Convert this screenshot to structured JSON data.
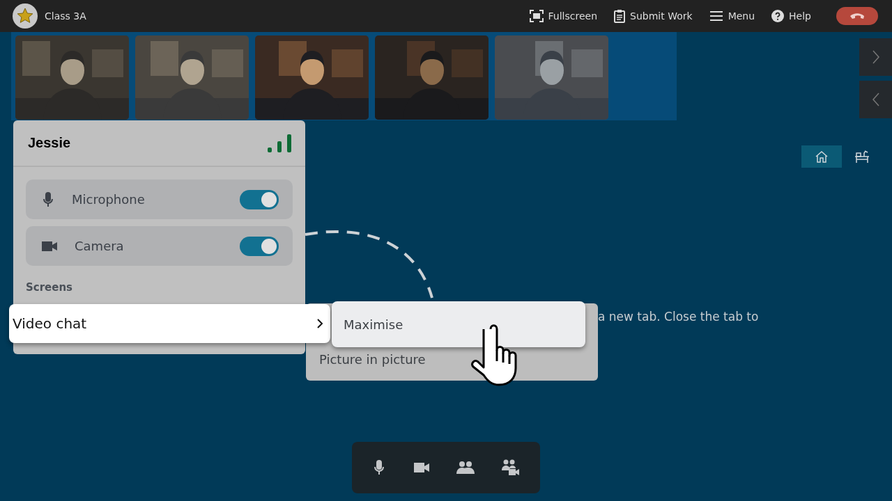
{
  "header": {
    "class_name": "Class 3A",
    "actions": [
      {
        "label": "Fullscreen",
        "kind": "fullscreen"
      },
      {
        "label": "Submit Work",
        "kind": "submit"
      },
      {
        "label": "Menu",
        "kind": "menu"
      },
      {
        "label": "Help",
        "kind": "help"
      }
    ]
  },
  "page_tabs": [
    {
      "kind": "home",
      "selected": true
    },
    {
      "kind": "desk",
      "selected": false
    }
  ],
  "background_text": "a new tab. Close the tab to",
  "participant_panel": {
    "name": "Jessie",
    "devices": [
      {
        "label": "Microphone",
        "kind": "microphone",
        "on": true
      },
      {
        "label": "Camera",
        "kind": "camera",
        "on": true
      }
    ],
    "section_label": "Screens",
    "menu_item": {
      "label": "Video chat",
      "selected": true
    }
  },
  "submenu": {
    "items": [
      {
        "label": "Maximise",
        "selected": true
      },
      {
        "label": "Picture in picture",
        "selected": false
      }
    ]
  },
  "toolbar": [
    {
      "kind": "microphone"
    },
    {
      "kind": "camera"
    },
    {
      "kind": "people"
    },
    {
      "kind": "breakout"
    }
  ]
}
